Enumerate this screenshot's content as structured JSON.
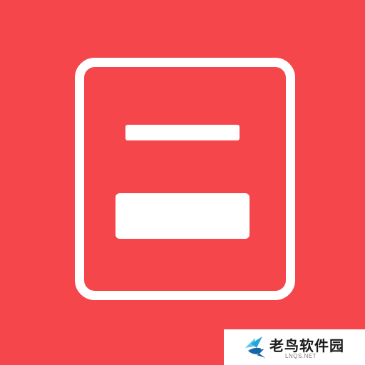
{
  "icon": {
    "background_color": "#f5474b",
    "foreground_color": "#ffffff",
    "glyph": "document-form-icon"
  },
  "watermark": {
    "name": "老鸟软件园",
    "domain": "LNQS.NET",
    "logo": "bird-logo-icon",
    "logo_colors": [
      "#2aa4d8",
      "#1565a8",
      "#5cc6ef"
    ]
  }
}
